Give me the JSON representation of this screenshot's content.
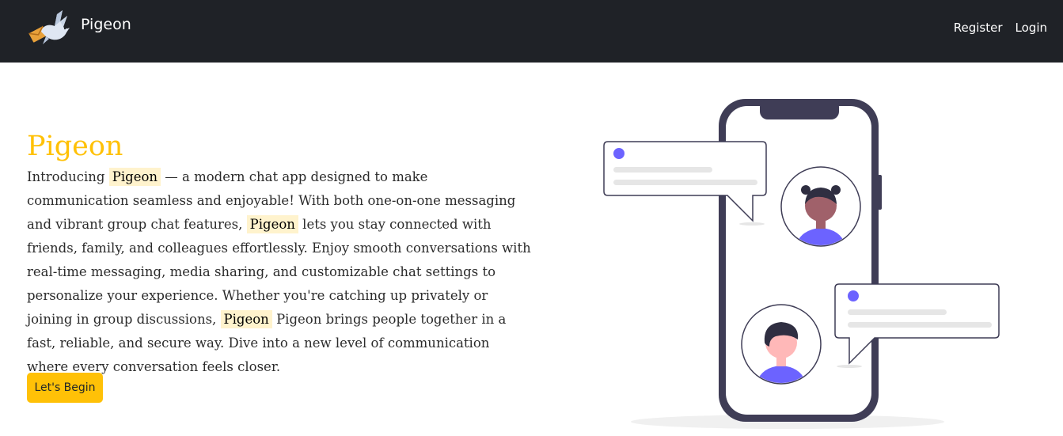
{
  "navbar": {
    "brand": "Pigeon",
    "logo_icon": "pigeon-with-letter-icon",
    "links": [
      "Register",
      "Login"
    ],
    "background": "#1f2227"
  },
  "hero": {
    "title": "Pigeon",
    "title_color": "#ffc107",
    "highlight_word": "Pigeon",
    "description": [
      "Introducing ",
      " — a modern chat app designed to make communication seamless and enjoyable! With both one-on-one messaging and vibrant group chat features, ",
      " lets you stay connected with friends, family, and colleagues effortlessly. Enjoy smooth conversations with real-time messaging, media sharing, and customizable chat settings to personalize your experience. Whether you're catching up privately or joining in group discussions, ",
      " Pigeon brings people together in a fast, reliable, and secure way. Dive into a new level of communication where every conversation feels closer."
    ],
    "cta_label": "Let's Begin",
    "cta_color": "#ffc107",
    "illustration_icon": "phone-chat-illustration-icon",
    "accent_color": "#6c63ff"
  }
}
